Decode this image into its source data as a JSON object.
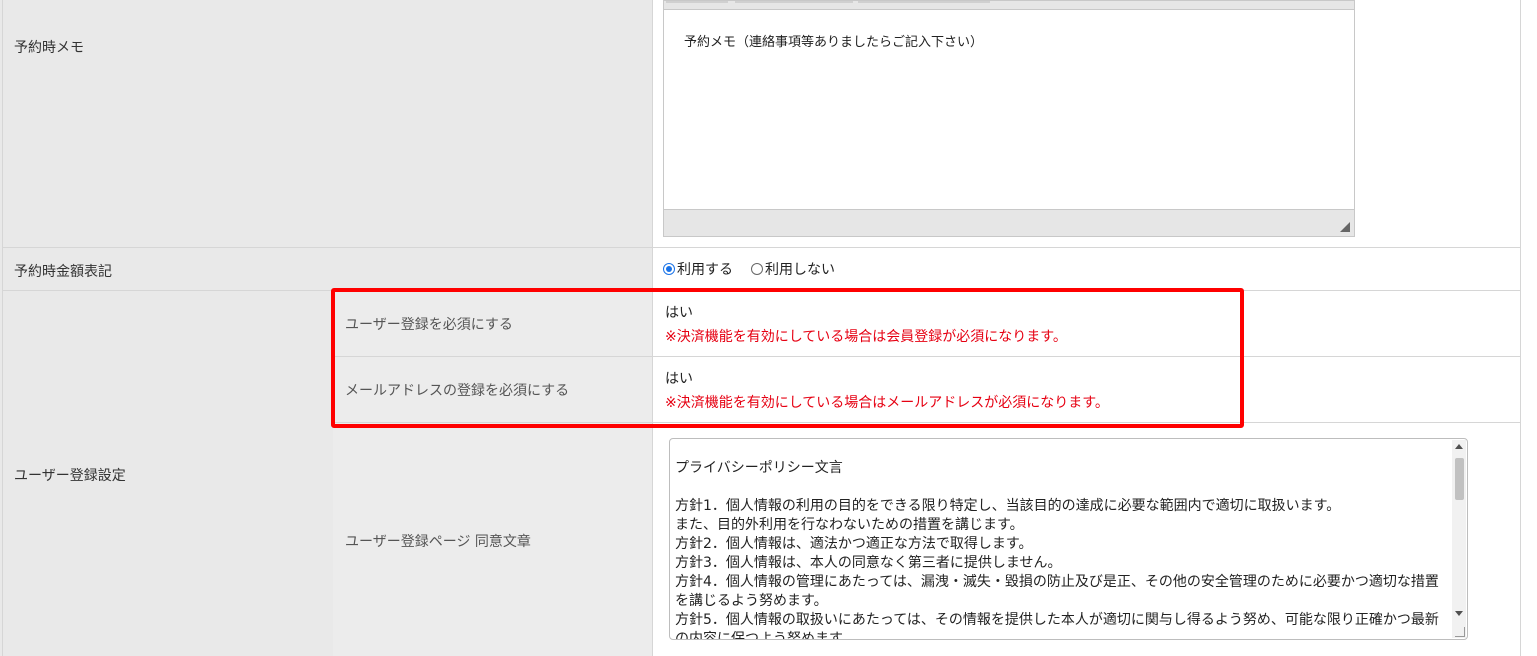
{
  "memo_row": {
    "label": "予約時メモ",
    "editor_content": "予約メモ（連絡事項等ありましたらご記入下さい）"
  },
  "price_row": {
    "label": "予約時金額表記",
    "options": [
      {
        "label": "利用する",
        "checked": true
      },
      {
        "label": "利用しない",
        "checked": false
      }
    ]
  },
  "user_registration": {
    "label": "ユーザー登録設定",
    "rows": [
      {
        "label": "ユーザー登録を必須にする",
        "value": "はい",
        "notice": "※決済機能を有効にしている場合は会員登録が必須になります。"
      },
      {
        "label": "メールアドレスの登録を必須にする",
        "value": "はい",
        "notice": "※決済機能を有効にしている場合はメールアドレスが必須になります。"
      },
      {
        "label": "ユーザー登録ページ 同意文章",
        "policy_text": "プライバシーポリシー文言\n\n方針1．個人情報の利用の目的をできる限り特定し、当該目的の達成に必要な範囲内で適切に取扱います。\nまた、目的外利用を行なわないための措置を講じます。\n方針2．個人情報は、適法かつ適正な方法で取得します。\n方針3．個人情報は、本人の同意なく第三者に提供しません。\n方針4．個人情報の管理にあたっては、漏洩・滅失・毀損の防止及び是正、その他の安全管理のために必要かつ適切な措置を講じるよう努めます。\n方針5．個人情報の取扱いにあたっては、その情報を提供した本人が適切に関与し得るよう努め、可能な限り正確かつ最新の内容に保つよう努めます。"
      }
    ]
  },
  "colors": {
    "label_bg": "#e9e9e9",
    "notice": "#e60012",
    "highlight": "#ff0000",
    "radio_accent": "#1a73e8"
  }
}
